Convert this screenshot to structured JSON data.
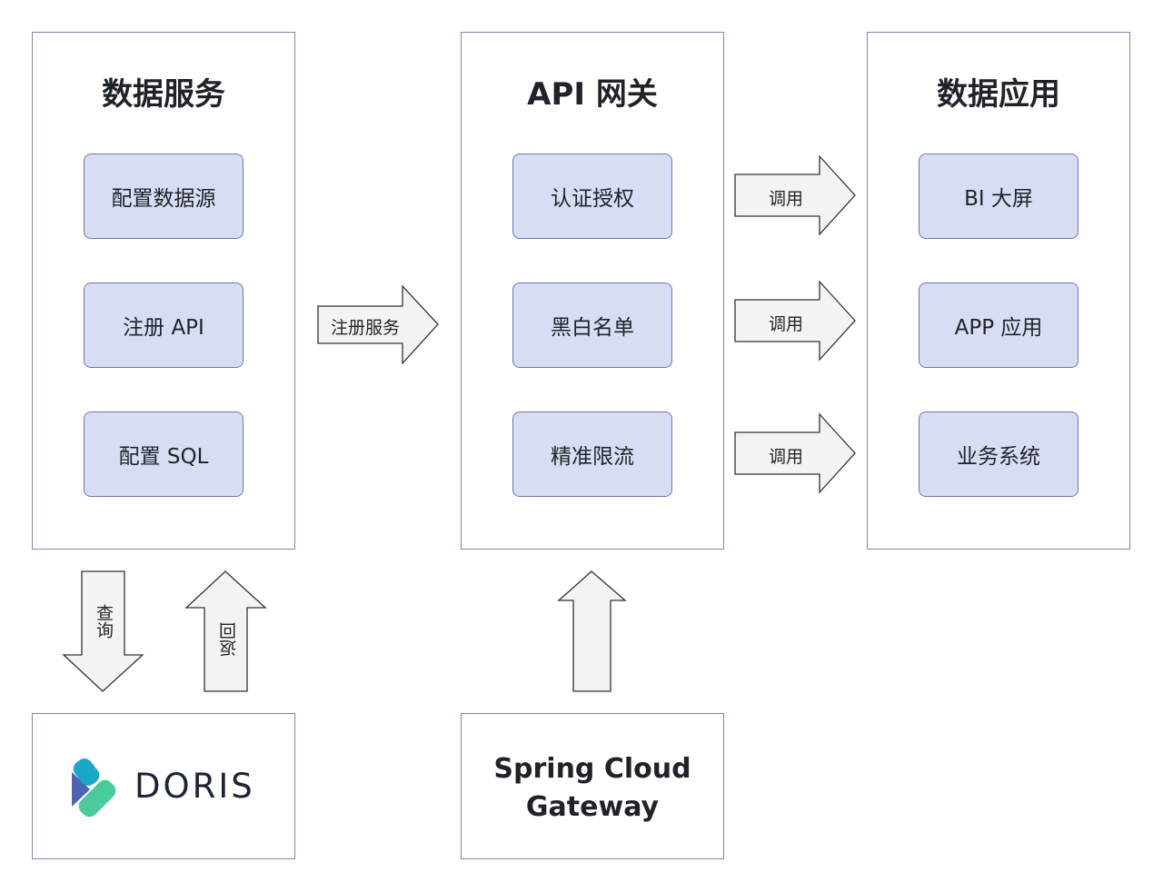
{
  "panels": {
    "data_service": {
      "title": "数据服务",
      "nodes": [
        "配置数据源",
        "注册 API",
        "配置 SQL"
      ]
    },
    "api_gateway": {
      "title": "API 网关",
      "nodes": [
        "认证授权",
        "黑白名单",
        "精准限流"
      ]
    },
    "data_apps": {
      "title": "数据应用",
      "nodes": [
        "BI 大屏",
        "APP 应用",
        "业务系统"
      ]
    }
  },
  "arrows": {
    "register": "注册服务",
    "invoke": [
      "调用",
      "调用",
      "调用"
    ],
    "query": "查询",
    "return": "返回"
  },
  "bottom": {
    "doris": {
      "name": "DORIS"
    },
    "gateway": {
      "line1": "Spring Cloud",
      "line2": "Gateway"
    }
  },
  "colors": {
    "panel_border": "#7a86b4",
    "node_fill": "#d8ddf3",
    "node_border": "#6c77b0",
    "arrow_fill": "#f3f3f3",
    "doris_blue": "#4f63b3",
    "doris_teal": "#1aa7c9",
    "doris_green": "#4ccb9a"
  }
}
